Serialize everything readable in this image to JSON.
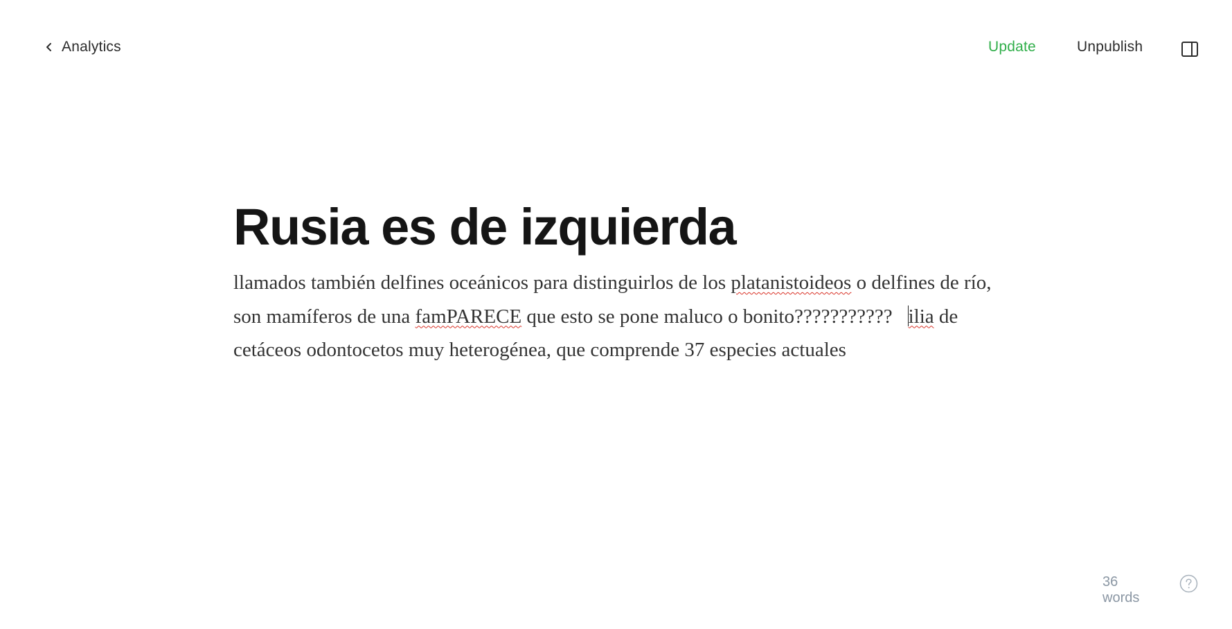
{
  "header": {
    "back_label": "Analytics",
    "update_label": "Update",
    "unpublish_label": "Unpublish",
    "accent_color": "#2fae49"
  },
  "post": {
    "title": "Rusia es de izquierda",
    "body": {
      "segment_1": " llamados también delfines oceánicos para distinguirlos de los ",
      "misspelled_1": "platanistoideos",
      "segment_2": " o delfines de río, son mamíferos de una ",
      "misspelled_2": "famPARECE",
      "segment_3": " que esto se pone maluco o bonito???????????",
      "misspelled_3": "ilia",
      "segment_4": " de cetáceos odontocetos muy heterogénea, que comprende 37 especies actuales"
    }
  },
  "footer": {
    "word_count": "36 words",
    "help_icon": "question-circle-icon"
  },
  "icons": {
    "back": "chevron-left-icon",
    "panel": "sidebar-toggle-icon"
  }
}
